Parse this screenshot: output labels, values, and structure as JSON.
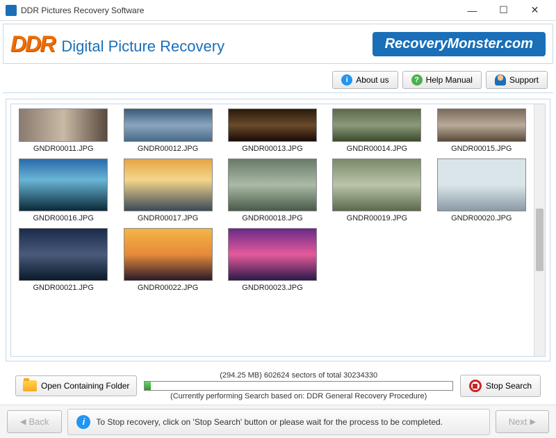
{
  "window": {
    "title": "DDR Pictures Recovery Software"
  },
  "header": {
    "logo_short": "DDR",
    "logo_title": "Digital Picture Recovery",
    "brand": "RecoveryMonster.com"
  },
  "toolbar": {
    "about": "About us",
    "help": "Help Manual",
    "support": "Support"
  },
  "gallery": {
    "items": [
      {
        "filename": "GNDR00011.JPG"
      },
      {
        "filename": "GNDR00012.JPG"
      },
      {
        "filename": "GNDR00013.JPG"
      },
      {
        "filename": "GNDR00014.JPG"
      },
      {
        "filename": "GNDR00015.JPG"
      },
      {
        "filename": "GNDR00016.JPG"
      },
      {
        "filename": "GNDR00017.JPG"
      },
      {
        "filename": "GNDR00018.JPG"
      },
      {
        "filename": "GNDR00019.JPG"
      },
      {
        "filename": "GNDR00020.JPG"
      },
      {
        "filename": "GNDR00021.JPG"
      },
      {
        "filename": "GNDR00022.JPG"
      },
      {
        "filename": "GNDR00023.JPG"
      }
    ]
  },
  "progress": {
    "open_folder": "Open Containing Folder",
    "status": "(294.25 MB) 602624  sectors  of  total 30234330",
    "note": "(Currently performing Search based on:  DDR General Recovery Procedure)",
    "stop": "Stop Search",
    "percent": 2
  },
  "footer": {
    "back": "Back",
    "next": "Next",
    "info": "To Stop recovery, click on 'Stop Search' button or please wait for the process to be completed."
  }
}
